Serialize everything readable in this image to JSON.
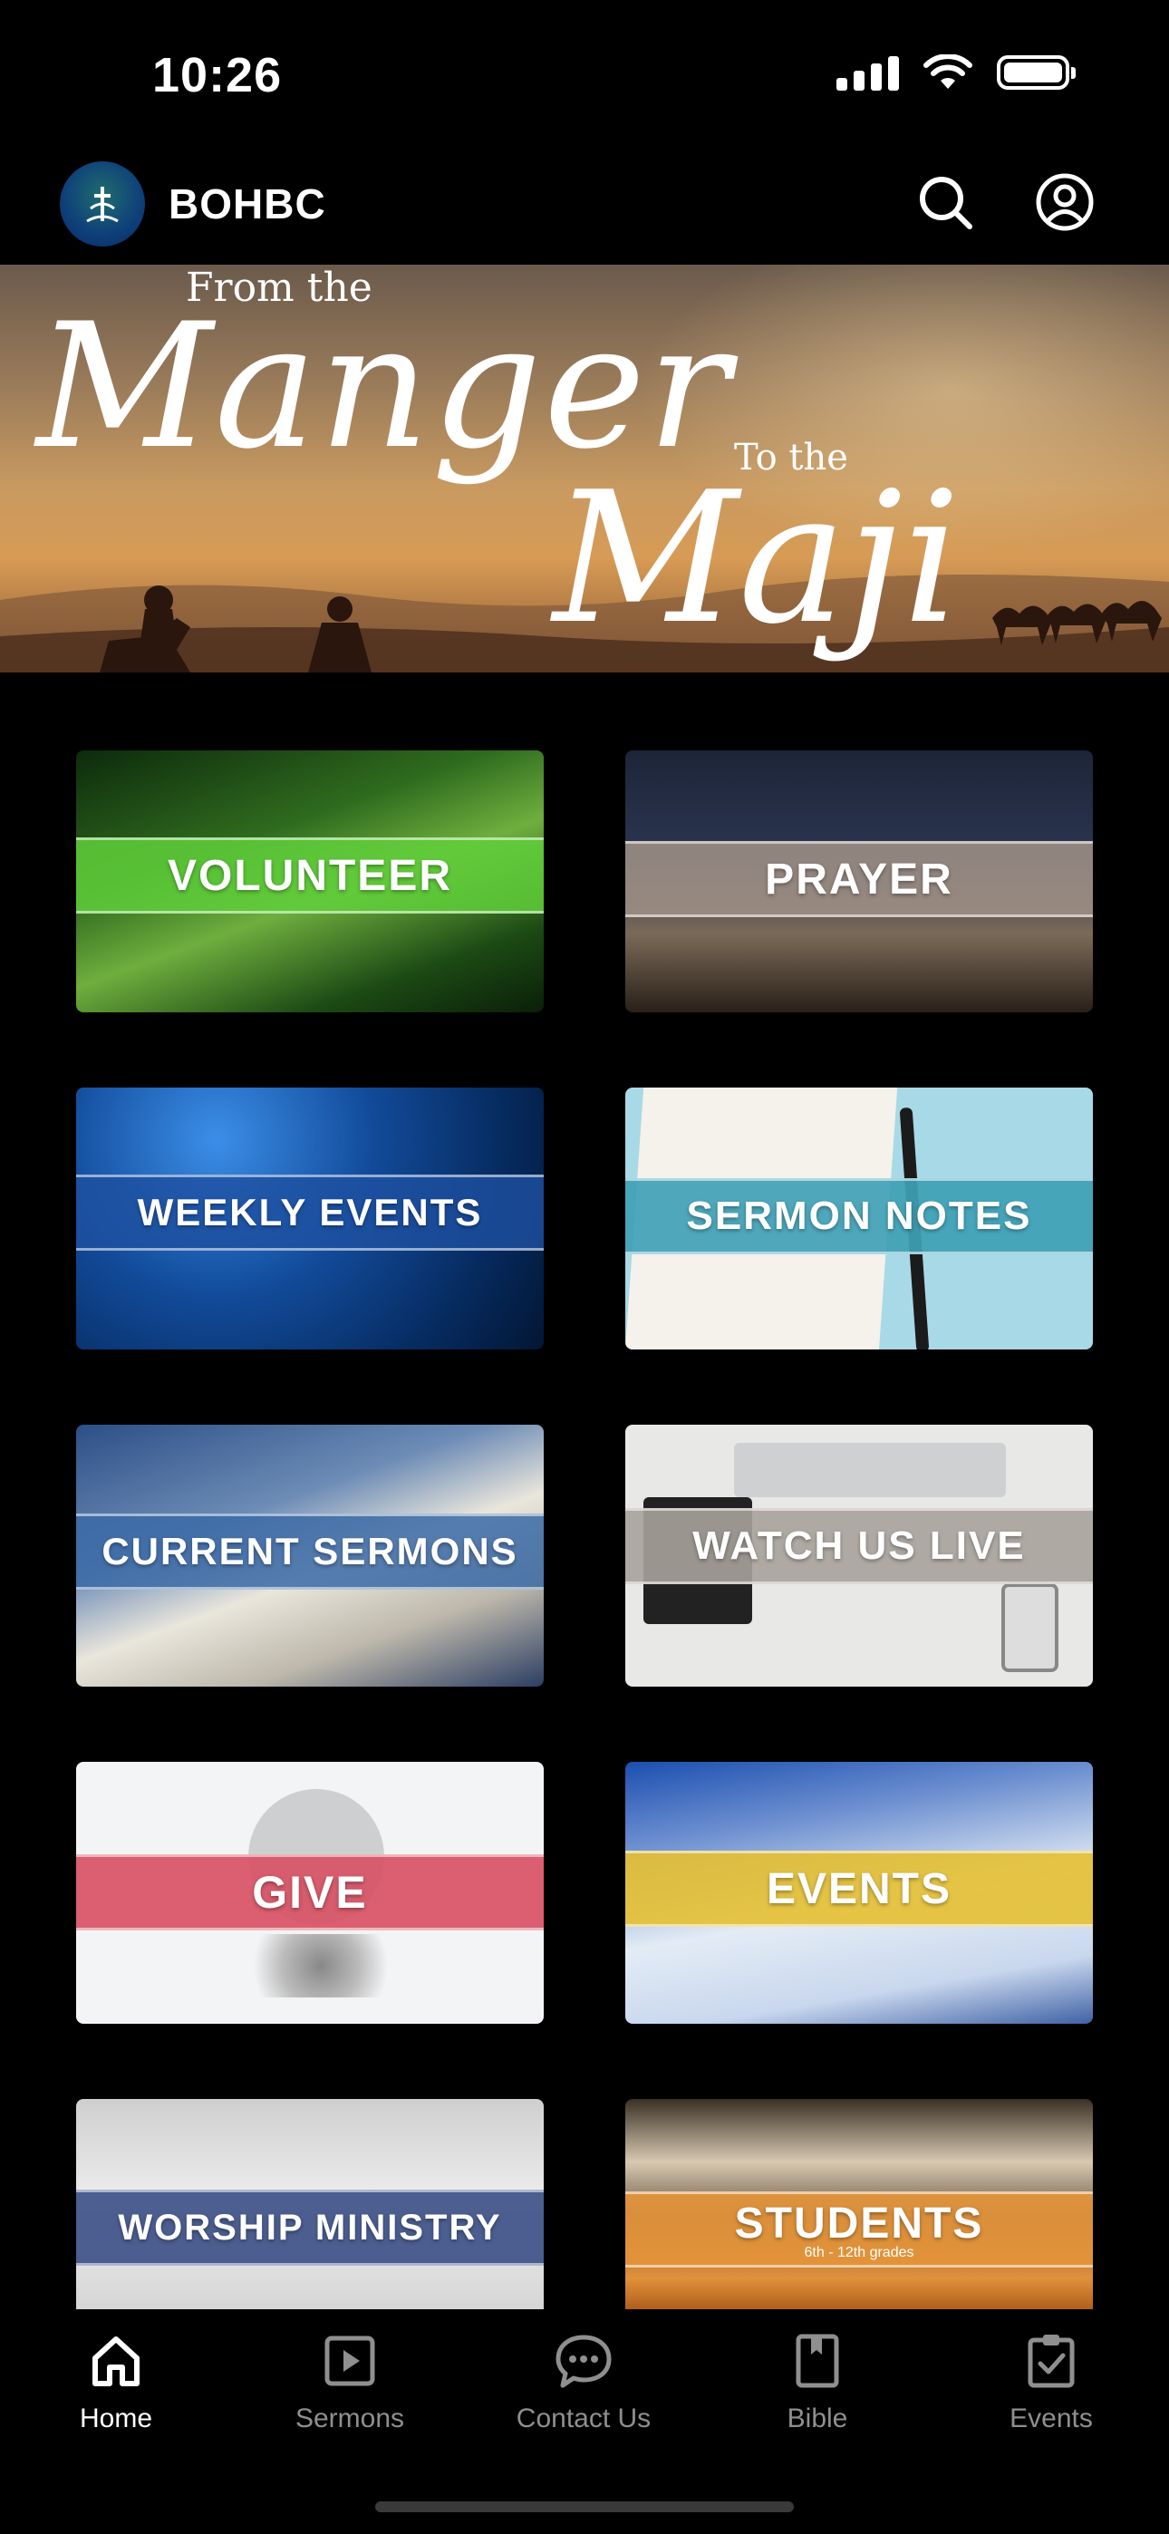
{
  "status_bar": {
    "time": "10:26"
  },
  "header": {
    "app_title": "BOHBC",
    "icons": [
      "search-icon",
      "account-icon"
    ]
  },
  "banner": {
    "line1": "From the",
    "line2": "Manger",
    "line3": "To the",
    "line4": "Maji"
  },
  "tiles": [
    {
      "label": "VOLUNTEER",
      "band_color": "#5fcf3a"
    },
    {
      "label": "PRAYER",
      "band_color": "#9e8f85"
    },
    {
      "label": "WEEKLY EVENTS",
      "band_color": "#2a5fa8"
    },
    {
      "label": "SERMON NOTES",
      "band_color": "#3fa1b6"
    },
    {
      "label": "CURRENT SERMONS",
      "band_color": "#3b6aa6"
    },
    {
      "label": "WATCH US LIVE",
      "band_color": "#a8a29b"
    },
    {
      "label": "GIVE",
      "band_color": "#d84f62"
    },
    {
      "label": "EVENTS",
      "band_color": "#e6c032"
    },
    {
      "label": "WORSHIP MINISTRY",
      "band_color": "#3b4f86"
    },
    {
      "label": "STUDENTS",
      "sub": "6th - 12th grades",
      "band_color": "#e6953a"
    }
  ],
  "tab_bar": {
    "tabs": [
      {
        "label": "Home",
        "icon": "home-icon",
        "active": true
      },
      {
        "label": "Sermons",
        "icon": "play-square-icon",
        "active": false
      },
      {
        "label": "Contact Us",
        "icon": "chat-bubble-icon",
        "active": false
      },
      {
        "label": "Bible",
        "icon": "book-icon",
        "active": false
      },
      {
        "label": "Events",
        "icon": "clipboard-check-icon",
        "active": false
      }
    ]
  }
}
